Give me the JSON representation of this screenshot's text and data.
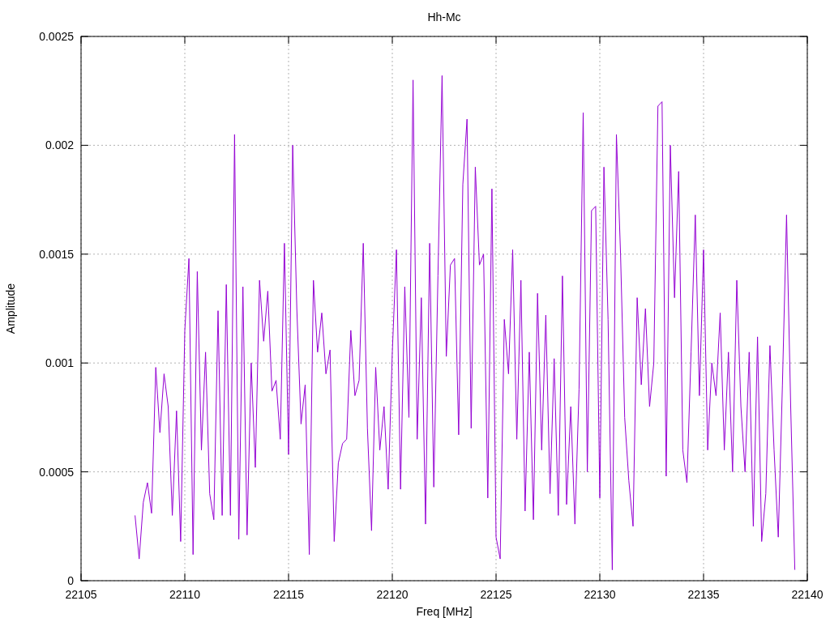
{
  "chart_data": {
    "type": "line",
    "title": "Hh-Mc",
    "xlabel": "Freq [MHz]",
    "ylabel": "Amplitude",
    "x": [
      22107.6,
      22107.8,
      22108,
      22108.2,
      22108.4,
      22108.6,
      22108.8,
      22109,
      22109.2,
      22109.4,
      22109.6,
      22109.8,
      22110,
      22110.2,
      22110.4,
      22110.6,
      22110.8,
      22111,
      22111.2,
      22111.4,
      22111.6,
      22111.8,
      22112,
      22112.2,
      22112.4,
      22112.6,
      22112.8,
      22113,
      22113.2,
      22113.4,
      22113.6,
      22113.8,
      22114,
      22114.2,
      22114.4,
      22114.6,
      22114.8,
      22115,
      22115.2,
      22115.4,
      22115.6,
      22115.8,
      22116,
      22116.2,
      22116.4,
      22116.6,
      22116.8,
      22117,
      22117.2,
      22117.4,
      22117.6,
      22117.8,
      22118,
      22118.2,
      22118.4,
      22118.6,
      22118.8,
      22119,
      22119.2,
      22119.4,
      22119.6,
      22119.8,
      22120,
      22120.2,
      22120.4,
      22120.6,
      22120.8,
      22121,
      22121.2,
      22121.4,
      22121.6,
      22121.8,
      22122,
      22122.2,
      22122.4,
      22122.6,
      22122.8,
      22123,
      22123.2,
      22123.4,
      22123.6,
      22123.8,
      22124,
      22124.2,
      22124.4,
      22124.6,
      22124.8,
      22125,
      22125.2,
      22125.4,
      22125.6,
      22125.8,
      22126,
      22126.2,
      22126.4,
      22126.6,
      22126.8,
      22127,
      22127.2,
      22127.4,
      22127.6,
      22127.8,
      22128,
      22128.2,
      22128.4,
      22128.6,
      22128.8,
      22129,
      22129.2,
      22129.4,
      22129.6,
      22129.8,
      22130,
      22130.2,
      22130.4,
      22130.6,
      22130.8,
      22131,
      22131.2,
      22131.4,
      22131.6,
      22131.8,
      22132,
      22132.2,
      22132.4,
      22132.6,
      22132.8,
      22133,
      22133.2,
      22133.4,
      22133.6,
      22133.8,
      22134,
      22134.2,
      22134.4,
      22134.6,
      22134.8,
      22135,
      22135.2,
      22135.4,
      22135.6,
      22135.8,
      22136,
      22136.2,
      22136.4,
      22136.6,
      22136.8,
      22137,
      22137.2,
      22137.4,
      22137.6,
      22137.8,
      22138,
      22138.2,
      22138.4,
      22138.6,
      22138.8,
      22139,
      22139.2,
      22139.4
    ],
    "series": [
      {
        "color": "#9400d3",
        "values": [
          0.0003,
          0.0001,
          0.00036,
          0.00045,
          0.00031,
          0.00098,
          0.00068,
          0.00095,
          0.0008,
          0.0003,
          0.00078,
          0.00018,
          0.00115,
          0.00148,
          0.00012,
          0.00142,
          0.0006,
          0.00105,
          0.0004,
          0.00028,
          0.00124,
          0.0003,
          0.00136,
          0.0003,
          0.00205,
          0.00019,
          0.00135,
          0.00021,
          0.001,
          0.00052,
          0.00138,
          0.0011,
          0.00133,
          0.00087,
          0.00092,
          0.00065,
          0.00155,
          0.00058,
          0.002,
          0.00125,
          0.00072,
          0.0009,
          0.00012,
          0.00138,
          0.00105,
          0.00123,
          0.00095,
          0.00106,
          0.00018,
          0.00054,
          0.00063,
          0.00065,
          0.00115,
          0.00085,
          0.00092,
          0.00155,
          0.0007,
          0.00023,
          0.00098,
          0.0006,
          0.0008,
          0.00042,
          0.00105,
          0.00152,
          0.00042,
          0.00135,
          0.00075,
          0.0023,
          0.00065,
          0.0013,
          0.00026,
          0.00155,
          0.00043,
          0.0014,
          0.00232,
          0.00103,
          0.00145,
          0.00148,
          0.00067,
          0.00182,
          0.00212,
          0.0007,
          0.0019,
          0.00145,
          0.0015,
          0.00038,
          0.0018,
          0.0002,
          0.0001,
          0.0012,
          0.00095,
          0.00152,
          0.00065,
          0.00138,
          0.00032,
          0.00105,
          0.00028,
          0.00132,
          0.0006,
          0.00122,
          0.0004,
          0.00102,
          0.0003,
          0.0014,
          0.00035,
          0.0008,
          0.00026,
          0.00088,
          0.00215,
          0.0005,
          0.0017,
          0.00172,
          0.00038,
          0.0019,
          0.0012,
          5e-05,
          0.00205,
          0.0015,
          0.00075,
          0.00046,
          0.00025,
          0.0013,
          0.0009,
          0.00125,
          0.0008,
          0.001,
          0.00218,
          0.0022,
          0.00048,
          0.002,
          0.0013,
          0.00188,
          0.0006,
          0.00045,
          0.00105,
          0.00168,
          0.00085,
          0.00152,
          0.0006,
          0.001,
          0.00085,
          0.00123,
          0.0006,
          0.00105,
          0.0005,
          0.00138,
          0.0008,
          0.0005,
          0.00105,
          0.00025,
          0.00112,
          0.00018,
          0.0004,
          0.00108,
          0.0006,
          0.0002,
          0.0009,
          0.00168,
          0.0008,
          5e-05
        ]
      }
    ],
    "grid": true,
    "xlim": [
      22105,
      22140
    ],
    "ylim": [
      0,
      0.0025
    ],
    "xticks": [
      22105,
      22110,
      22115,
      22120,
      22125,
      22130,
      22135,
      22140
    ],
    "yticks": [
      0,
      0.0005,
      0.001,
      0.0015,
      0.002,
      0.0025
    ]
  }
}
